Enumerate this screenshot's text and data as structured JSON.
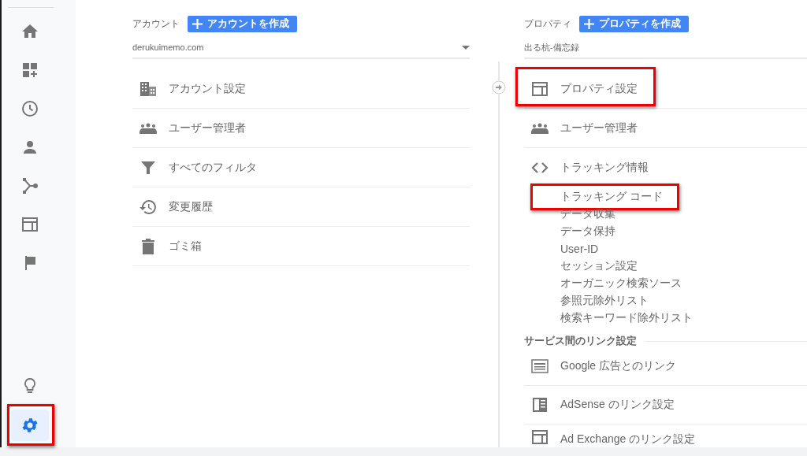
{
  "sidebar": {
    "items": [
      {
        "kind": "home",
        "selected": false
      },
      {
        "kind": "dashboard",
        "selected": false
      },
      {
        "kind": "clock",
        "selected": false
      },
      {
        "kind": "person",
        "selected": false
      },
      {
        "kind": "fork",
        "selected": false
      },
      {
        "kind": "layout",
        "selected": false
      },
      {
        "kind": "flag",
        "selected": false
      }
    ],
    "bottom_items": [
      {
        "kind": "lightbulb",
        "selected": false,
        "highlighted": false
      },
      {
        "kind": "gear",
        "selected": true,
        "highlighted": true
      }
    ]
  },
  "account": {
    "label": "アカウント",
    "create_button": "アカウントを作成",
    "selector": "derukuimemo.com",
    "items": [
      {
        "kind": "building",
        "label": "アカウント設定"
      },
      {
        "kind": "people",
        "label": "ユーザー管理者"
      },
      {
        "kind": "filter",
        "label": "すべてのフィルタ"
      },
      {
        "kind": "history",
        "label": "変更履歴"
      },
      {
        "kind": "trash",
        "label": "ゴミ箱"
      }
    ]
  },
  "property": {
    "label": "プロパティ",
    "create_button": "プロパティを作成",
    "selector": "出る杭-備忘録",
    "items": [
      {
        "kind": "layout",
        "label": "プロパティ設定",
        "highlighted": true
      },
      {
        "kind": "people",
        "label": "ユーザー管理者",
        "highlighted": false
      },
      {
        "kind": "code",
        "label": "トラッキング情報",
        "highlighted": false,
        "children": [
          {
            "label": "トラッキング コード",
            "highlighted": true
          },
          {
            "label": "データ収集",
            "highlighted": false
          },
          {
            "label": "データ保持",
            "highlighted": false
          },
          {
            "label": "User-ID",
            "highlighted": false
          },
          {
            "label": "セッション設定",
            "highlighted": false
          },
          {
            "label": "オーガニック検索ソース",
            "highlighted": false
          },
          {
            "label": "参照元除外リスト",
            "highlighted": false
          },
          {
            "label": "検索キーワード除外リスト",
            "highlighted": false
          }
        ]
      }
    ],
    "section_title": "サービス間のリンク設定",
    "link_items": [
      {
        "kind": "ads",
        "label": "Google 広告とのリンク"
      },
      {
        "kind": "adsense",
        "label": "AdSense のリンク設定"
      },
      {
        "kind": "window",
        "label": "Ad Exchange のリンク設定"
      }
    ]
  }
}
